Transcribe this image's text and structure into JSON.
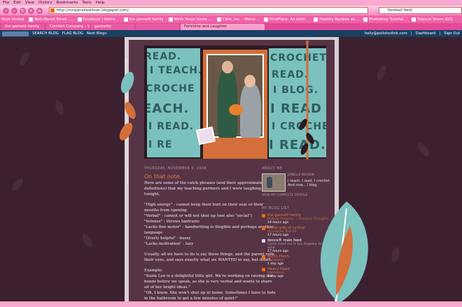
{
  "browser": {
    "menu": [
      "File",
      "Edit",
      "View",
      "History",
      "Bookmarks",
      "Tools",
      "Help"
    ],
    "url": "http://mrsjanellewilson.blogspot.com/",
    "search_value": "football field",
    "bookmarks": [
      "Most Visited",
      "Web-Based Email :...",
      "Facebook | Welco...",
      "the gannett family",
      "Wells Fargo Home ...",
      "CNet, Inc. - Welco...",
      "PrintPlace: An onlin...",
      "Healthy Recipes an...",
      "Photoshop Tutorial...",
      "Tropical Storm GUS"
    ],
    "tabs": [
      {
        "label": "the gannett family",
        "active": false
      },
      {
        "label": "Comfort Company - Vicki...",
        "active": false
      },
      {
        "label": "gannette",
        "active": false
      },
      {
        "label": "",
        "active": false
      },
      {
        "label": "Feminine and Laughter",
        "active": true
      }
    ]
  },
  "blogger_bar": {
    "search_label": "SEARCH BLOG",
    "flag_label": "FLAG BLOG",
    "next_label": "Next Blog»",
    "account": "holly@polishedink.com",
    "dashboard": "Dashboard",
    "signout": "Sign Out"
  },
  "header": {
    "words_left": [
      "READ.",
      "I TEACH.",
      "CROCHE",
      "EACH.",
      "I READ.",
      "I RE"
    ],
    "words_right": [
      "CROCHET",
      "READ.",
      "I BLOG.",
      "I READ",
      "I CROCHE",
      "I READ."
    ]
  },
  "post": {
    "date": "THURSDAY, NOVEMBER 6, 2008",
    "title": "On that note.",
    "paragraphs": [
      "Here are some of the catch phrases (and their approximate definitions) that my teaching partners and I were laughing about tonight.",
      "\"High energy\" - cannot keep their butt on their seat or their mouths from opening",
      "\"Verbal\" - cannot or will not shut up (see also \"social\")",
      "\"Intense\" - throws tantrums",
      "\"Lacks fine motor\" - handwriting is illegible and perhaps another language",
      "\"Overly helpful\" - bossy",
      "\"Lacks motivation\" - lazy",
      "Usually, all we have to do is say these things, and the parent rolls their eyes, and says exactly what we WANTED to say, but didn't.",
      "Example:",
      "\"Suzie Loo is a delightful little girl. We're working on raising our hands before we speak, as she is very verbal and wants to share all of her bright ideas.\"",
      "\"Oh, I know. She won't shut up at home. Sometimes I have to hide in the bathroom to get a few minutes of quiet!\""
    ]
  },
  "sidebar": {
    "about_title": "ABOUT ME",
    "about_name": "JANELLE WILSON",
    "about_text": "I teach. I read. I crochet. And now... I blog.",
    "view_profile": "VIEW MY COMPLETE PROFILE",
    "bloglist_title": "MY BLOG LIST",
    "blogs": [
      {
        "title": "the gannett family",
        "sub": "Making Progress ... Random Thoughts",
        "ago": "14 hours ago"
      },
      {
        "title": "softer side of cynical",
        "sub": "Wonderful Texture",
        "ago": "17 hours ago"
      },
      {
        "title": "dooce® main feed",
        "sub": "Come meet me in Los Angeles, bring wine",
        "ago": "17 hours ago"
      },
      {
        "title": "Burch Perch",
        "sub": "Maddoken",
        "ago": "1 day ago"
      },
      {
        "title": "Heavy Head",
        "sub": "Halloween",
        "ago": "1 day ago"
      }
    ]
  },
  "colors": {
    "accent": "#e07b3e",
    "teal": "#7bc1bd",
    "background": "#3b2130",
    "chrome": "#f062a8"
  }
}
